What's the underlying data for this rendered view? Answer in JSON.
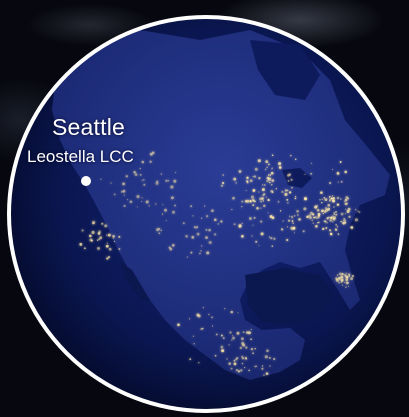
{
  "marker": {
    "city": "Seattle",
    "company": "Leostella LCC"
  },
  "colors": {
    "ocean": "#0b1a55",
    "land": "#1a2a7a",
    "city_lights": "#ffe9a8",
    "globe_border": "#ffffff",
    "marker": "#ffffff"
  }
}
